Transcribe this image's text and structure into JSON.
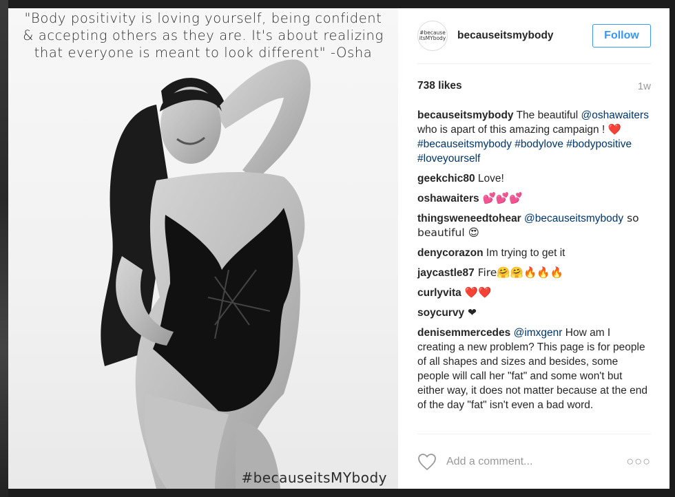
{
  "photo": {
    "quote_lines": [
      "\"Body positivity is loving yourself, being confident",
      "& accepting others as they are. It's about realizing",
      "that everyone is meant to look different\" -Osha"
    ],
    "hashtag": "#becauseitsMYbody"
  },
  "header": {
    "avatar_line1": "#because",
    "avatar_line2": "itsMYbody",
    "username": "becauseitsmybody",
    "follow_label": "Follow"
  },
  "stats": {
    "likes": "738 likes",
    "time": "1w"
  },
  "caption": {
    "user": "becauseitsmybody",
    "text1": " The beautiful ",
    "mention": "@oshawaiters",
    "text2": " who is apart of this amazing campaign ! ",
    "emoji": "❤️",
    "hashtags": " #becauseitsmybody #bodylove #bodypositive #loveyourself"
  },
  "comments": [
    {
      "user": "geekchic80",
      "text": " Love!"
    },
    {
      "user": "oshawaiters",
      "text": " 💕💕💕"
    },
    {
      "user": "thingsweneedtohear",
      "mention": " @becauseitsmybody",
      "text": " so beautiful 😍"
    },
    {
      "user": "denycorazon",
      "text": " Im trying to get it"
    },
    {
      "user": "jaycastle87",
      "text": " Fire🤗🤗🔥🔥🔥"
    },
    {
      "user": "curlyvita",
      "text": " ❤️❤️"
    },
    {
      "user": "soycurvy",
      "text": " ❤"
    },
    {
      "user": "denisemmercedes",
      "mention": " @imxgenr",
      "text": " How am I creating a new problem? This page is for people of all shapes and sizes and besides, some people will call her \"fat\" and some won't but either way, it does not matter because at the end of the day \"fat\" isn't even a bad word."
    }
  ],
  "footer": {
    "heart_icon": "heart-outline-icon",
    "add_comment_placeholder": "Add a comment...",
    "more_label": "○○○"
  }
}
